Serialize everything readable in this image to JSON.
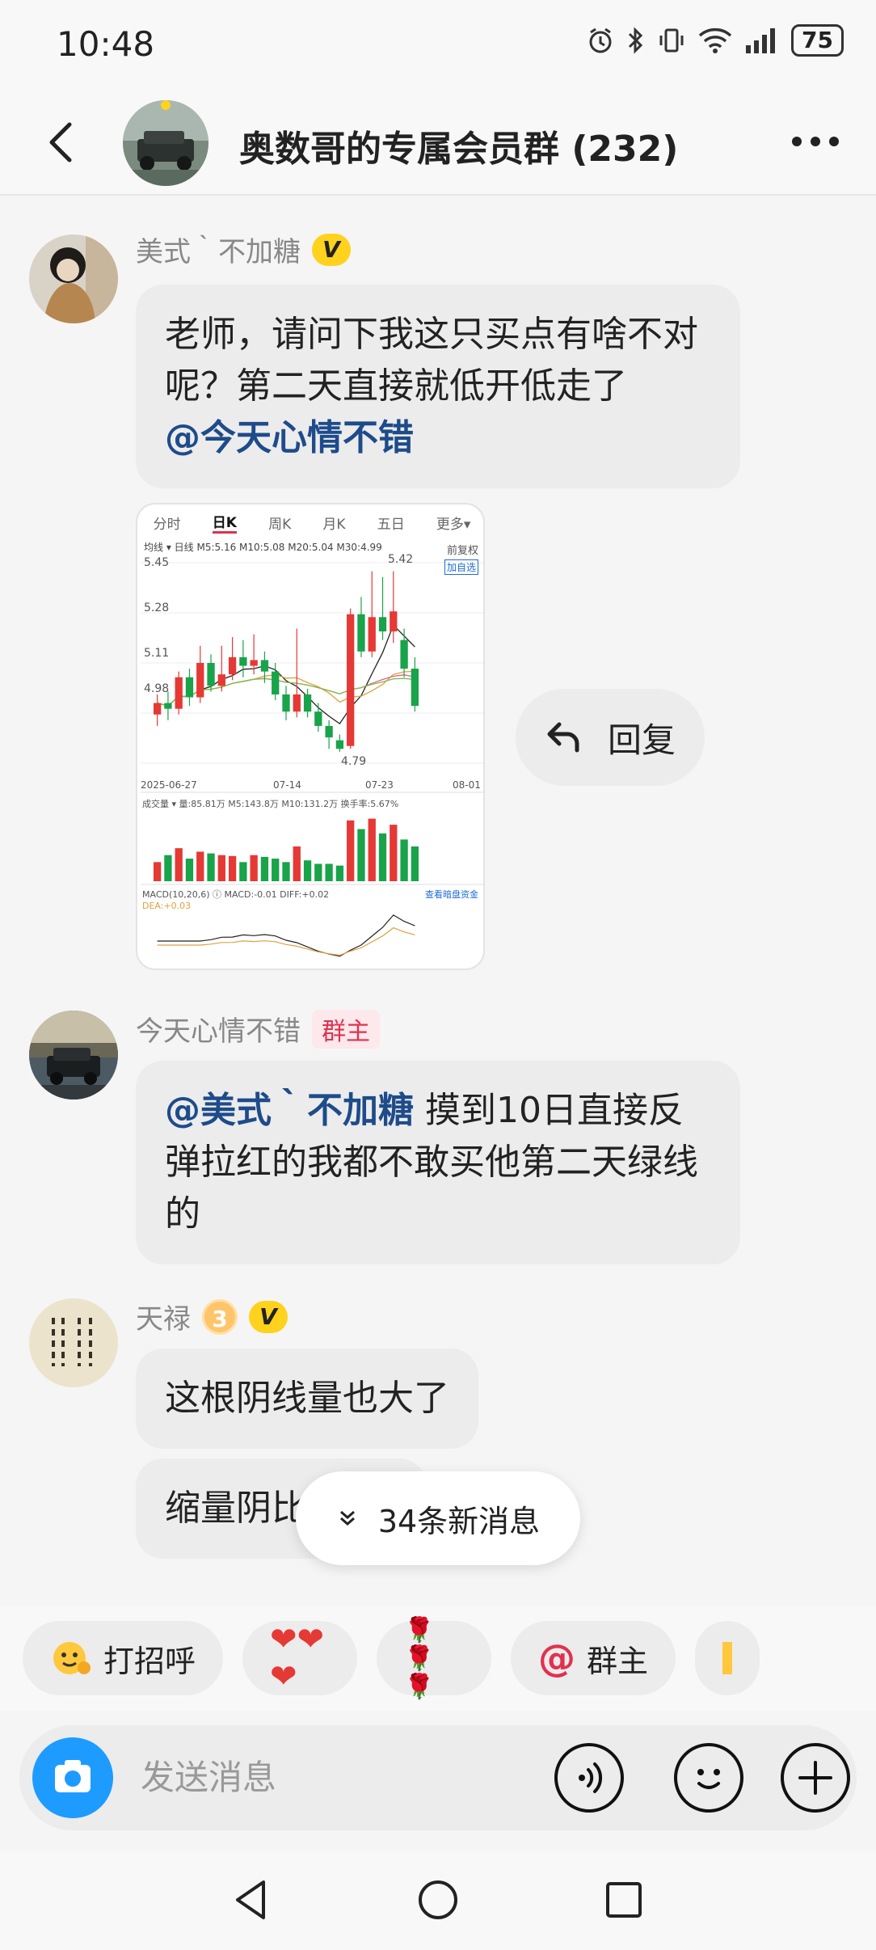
{
  "status": {
    "time": "10:48",
    "battery": "75"
  },
  "header": {
    "title": "奥数哥的专属会员群 (232)"
  },
  "messages": [
    {
      "sender": "美式｀不加糖",
      "badge": "V",
      "text_1": "老师，请问下我这只买点有啥不对呢？第二天直接就低开低走了",
      "mention": "@今天心情不错"
    },
    {
      "sender": "今天心情不错",
      "role": "群主",
      "mention": "@美式｀不加糖",
      "text": " 摸到10日直接反弹拉红的我都不敢买他第二天绿线的"
    },
    {
      "sender": "天禄",
      "level": "3",
      "badge": "V",
      "text": "这根阴线量也大了",
      "text_2": "缩量阴比"
    }
  ],
  "reply_button": {
    "label": "回复"
  },
  "new_messages": {
    "label": "34条新消息"
  },
  "quick_replies": [
    {
      "label": "打招呼",
      "icon": "wave-emoji-icon"
    },
    {
      "label": "❤❤❤",
      "icon": "hearts-icon"
    },
    {
      "label": "🌹 🌹 🌹",
      "icon": "roses-icon"
    },
    {
      "label": "群主",
      "icon": "at-icon"
    }
  ],
  "input": {
    "placeholder": "发送消息"
  },
  "chart_image": {
    "tabs": [
      "分时",
      "日K",
      "周K",
      "月K",
      "五日",
      "更多▾"
    ],
    "active_tab": "日K",
    "ma_legend": "均线 ▾  日线  M5:5.16  M10:5.08  M20:5.04  M30:4.99",
    "restore": "前复权",
    "add_label": "加自选",
    "price_labels": [
      "5.45",
      "5.28",
      "5.11",
      "4.98"
    ],
    "high_label": "5.42",
    "low_label": "4.79",
    "dates": [
      "2025-06-27",
      "07-14",
      "07-23",
      "08-01"
    ],
    "volume_legend": "成交量 ▾  量:85.81万  M5:143.8万  M10:131.2万  换手率:5.67%",
    "macd_legend": "MACD(10,20,6) ⓘ  MACD:-0.01  DIFF:+0.02",
    "macd_link": "查看暗盘资金",
    "dea": "DEA:+0.03",
    "candles": [
      {
        "o": 4.92,
        "c": 4.96,
        "h": 4.99,
        "l": 4.88
      },
      {
        "o": 4.96,
        "c": 4.94,
        "h": 5.0,
        "l": 4.9
      },
      {
        "o": 4.94,
        "c": 5.05,
        "h": 5.07,
        "l": 4.92
      },
      {
        "o": 5.05,
        "c": 4.98,
        "h": 5.08,
        "l": 4.95
      },
      {
        "o": 4.98,
        "c": 5.1,
        "h": 5.16,
        "l": 4.96
      },
      {
        "o": 5.1,
        "c": 5.02,
        "h": 5.13,
        "l": 5.0
      },
      {
        "o": 5.02,
        "c": 5.06,
        "h": 5.16,
        "l": 5.0
      },
      {
        "o": 5.06,
        "c": 5.12,
        "h": 5.19,
        "l": 5.04
      },
      {
        "o": 5.12,
        "c": 5.09,
        "h": 5.18,
        "l": 5.05
      },
      {
        "o": 5.09,
        "c": 5.11,
        "h": 5.2,
        "l": 5.06
      },
      {
        "o": 5.11,
        "c": 5.07,
        "h": 5.14,
        "l": 5.03
      },
      {
        "o": 5.07,
        "c": 4.99,
        "h": 5.1,
        "l": 4.97
      },
      {
        "o": 4.99,
        "c": 4.93,
        "h": 5.02,
        "l": 4.9
      },
      {
        "o": 4.93,
        "c": 4.99,
        "h": 5.22,
        "l": 4.91
      },
      {
        "o": 4.99,
        "c": 4.93,
        "h": 5.01,
        "l": 4.91
      },
      {
        "o": 4.93,
        "c": 4.88,
        "h": 4.96,
        "l": 4.86
      },
      {
        "o": 4.88,
        "c": 4.84,
        "h": 4.9,
        "l": 4.8
      },
      {
        "o": 4.83,
        "c": 4.8,
        "h": 4.85,
        "l": 4.79
      },
      {
        "o": 4.81,
        "c": 5.27,
        "h": 5.29,
        "l": 4.8
      },
      {
        "o": 5.27,
        "c": 5.14,
        "h": 5.33,
        "l": 5.12
      },
      {
        "o": 5.14,
        "c": 5.26,
        "h": 5.42,
        "l": 5.12
      },
      {
        "o": 5.26,
        "c": 5.21,
        "h": 5.4,
        "l": 5.18
      },
      {
        "o": 5.21,
        "c": 5.28,
        "h": 5.42,
        "l": 5.17
      },
      {
        "o": 5.18,
        "c": 5.08,
        "h": 5.22,
        "l": 5.05
      },
      {
        "o": 5.08,
        "c": 4.95,
        "h": 5.12,
        "l": 4.93
      }
    ],
    "volumes": [
      22,
      30,
      38,
      26,
      34,
      32,
      30,
      29,
      22,
      30,
      28,
      26,
      22,
      40,
      24,
      20,
      20,
      18,
      70,
      60,
      72,
      55,
      65,
      48,
      40
    ]
  }
}
